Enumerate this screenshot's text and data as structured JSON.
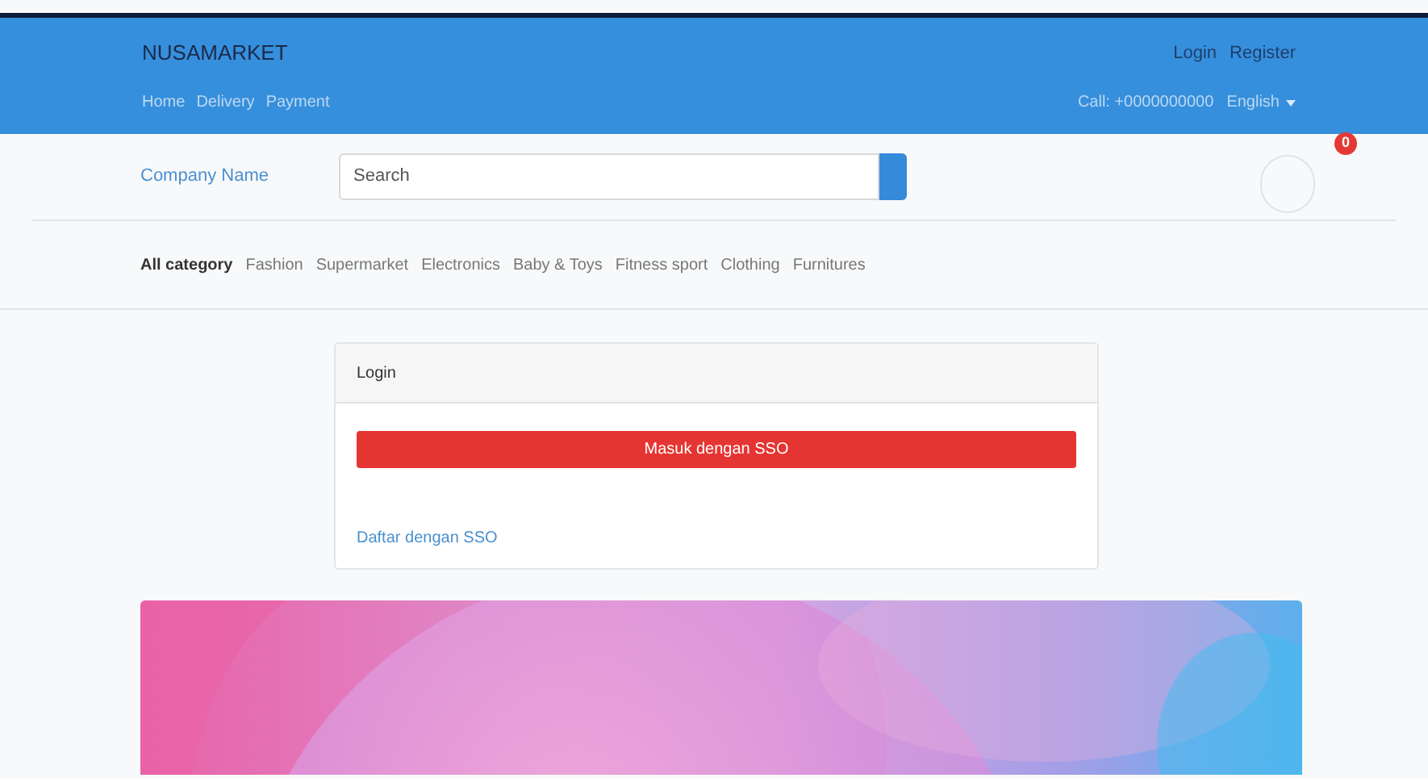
{
  "header": {
    "brand": "NUSAMARKET",
    "nav": [
      "Home",
      "Delivery",
      "Payment"
    ],
    "account_links": [
      "Login",
      "Register"
    ],
    "phone": "Call: +0000000000",
    "language": "English"
  },
  "search_bar": {
    "company": "Company Name",
    "placeholder": "Search",
    "cart_count": "0"
  },
  "categories": [
    {
      "label": "All category",
      "selected": true
    },
    {
      "label": "Fashion",
      "selected": false
    },
    {
      "label": "Supermarket",
      "selected": false
    },
    {
      "label": "Electronics",
      "selected": false
    },
    {
      "label": "Baby & Toys",
      "selected": false
    },
    {
      "label": "Fitness sport",
      "selected": false
    },
    {
      "label": "Clothing",
      "selected": false
    },
    {
      "label": "Furnitures",
      "selected": false
    }
  ],
  "login_card": {
    "title": "Login",
    "sso_button": "Masuk dengan SSO",
    "register_link": "Daftar dengan SSO"
  }
}
